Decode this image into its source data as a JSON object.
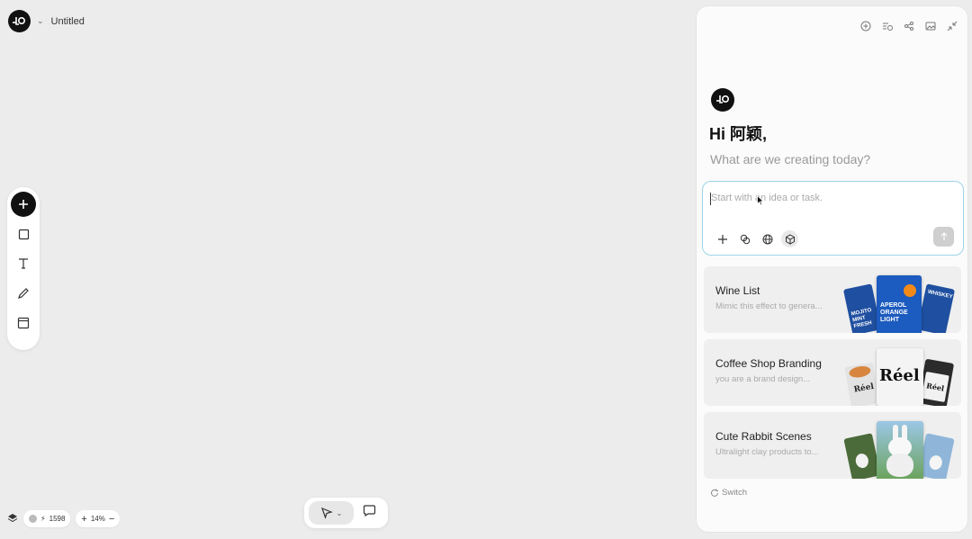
{
  "app": {
    "logo_icon": "lovart-logo",
    "document_title": "Untitled"
  },
  "toolbar_left": {
    "tools": [
      {
        "name": "add-tool",
        "icon": "plus-icon"
      },
      {
        "name": "shape-tool",
        "icon": "square-icon"
      },
      {
        "name": "text-tool",
        "icon": "text-icon"
      },
      {
        "name": "pen-tool",
        "icon": "pencil-icon"
      },
      {
        "name": "frame-tool",
        "icon": "frame-icon"
      }
    ]
  },
  "bottom_left": {
    "credits": "1598",
    "zoom_level": "14%"
  },
  "panel": {
    "greeting": "Hi 阿颖,",
    "subgreeting": "What are we creating today?",
    "input_placeholder": "Start with an idea or task.",
    "switch_label": "Switch",
    "cards": [
      {
        "title": "Wine List",
        "description": "Mimic this effect to genera..."
      },
      {
        "title": "Coffee Shop Branding",
        "description": "you are a brand design..."
      },
      {
        "title": "Cute Rabbit Scenes",
        "description": "Ultralight clay products to..."
      }
    ],
    "thumbnail_text": {
      "wine_left": "MOJITO MINT FRESH",
      "wine_center": "APEROL ORANGE LIGHT",
      "wine_right": "WHISKEY",
      "coffee_center": "Réel",
      "coffee_left": "Réel",
      "coffee_right": "Réel"
    }
  },
  "colors": {
    "accent_border": "#9dd3e8",
    "canvas_bg": "#ececec",
    "panel_bg": "#fbfbfb"
  }
}
